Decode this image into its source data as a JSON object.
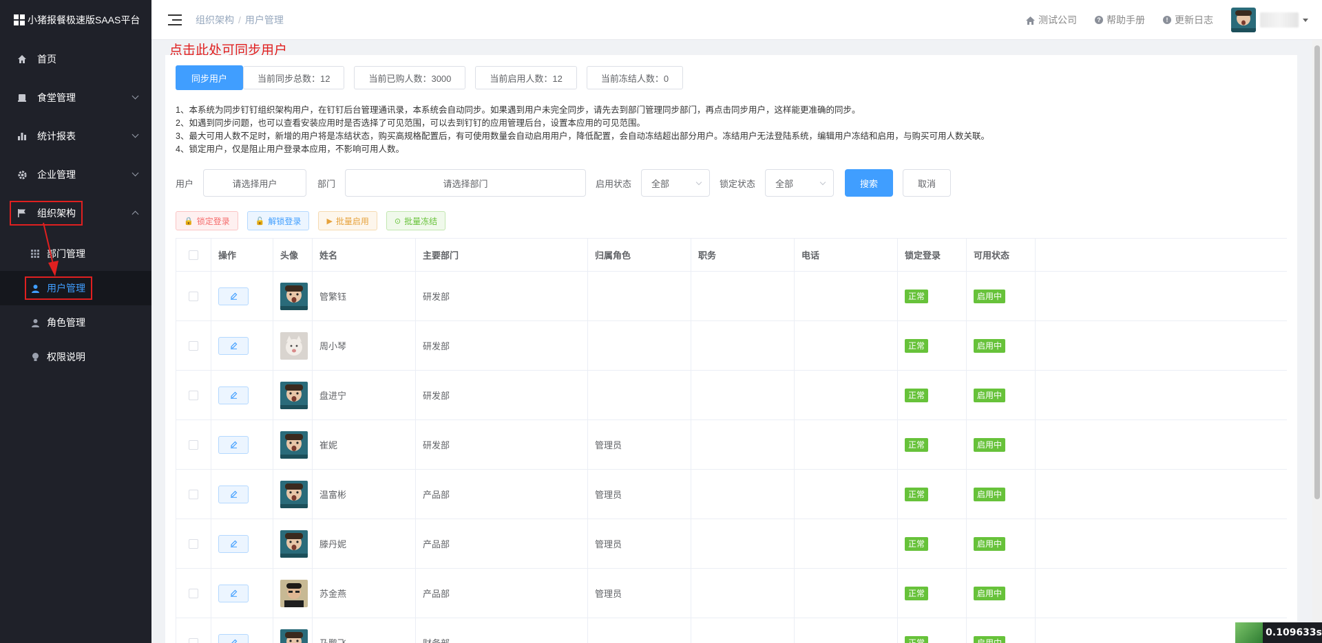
{
  "app": {
    "title": "小猪报餐极速版SAAS平台"
  },
  "sidebar": {
    "items": [
      {
        "label": "首页",
        "icon": "home-icon",
        "expandable": false
      },
      {
        "label": "食堂管理",
        "icon": "canteen-icon",
        "expandable": true
      },
      {
        "label": "统计报表",
        "icon": "chart-icon",
        "expandable": true
      },
      {
        "label": "企业管理",
        "icon": "gear-icon",
        "expandable": true
      },
      {
        "label": "组织架构",
        "icon": "flag-icon",
        "expandable": true,
        "expanded": true
      }
    ],
    "subitems": [
      {
        "label": "部门管理",
        "icon": "grid-icon"
      },
      {
        "label": "用户管理",
        "icon": "user-icon",
        "active": true
      },
      {
        "label": "角色管理",
        "icon": "user-icon"
      },
      {
        "label": "权限说明",
        "icon": "bulb-icon"
      }
    ]
  },
  "header": {
    "breadcrumb": [
      "组织架构",
      "用户管理"
    ],
    "links": [
      {
        "label": "测试公司",
        "icon": "home-icon"
      },
      {
        "label": "帮助手册",
        "icon": "question-icon"
      },
      {
        "label": "更新日志",
        "icon": "info-icon"
      }
    ]
  },
  "annotation": "点击此处可同步用户",
  "sync": {
    "button": "同步用户",
    "stats": [
      "当前同步总数：12",
      "当前已购人数：3000",
      "当前启用人数：12",
      "当前冻结人数：0"
    ]
  },
  "notes": [
    "1、本系统为同步钉钉组织架构用户，在钉钉后台管理通讯录，本系统会自动同步。如果遇到用户未完全同步，请先去到部门管理同步部门，再点击同步用户，这样能更准确的同步。",
    "2、如遇到同步问题，也可以查看安装应用时是否选择了可见范围，可以去到钉钉的应用管理后台，设置本应用的可见范围。",
    "3、最大可用人数不足时，新增的用户将是冻结状态，购买高规格配置后，有可使用数量会自动启用用户，降低配置，会自动冻结超出部分用户。冻结用户无法登陆系统，编辑用户冻结和启用，与购买可用人数关联。",
    "4、锁定用户，仅是阻止用户登录本应用，不影响可用人数。"
  ],
  "filters": {
    "user_label": "用户",
    "user_placeholder": "请选择用户",
    "dept_label": "部门",
    "dept_placeholder": "请选择部门",
    "enable_label": "启用状态",
    "enable_value": "全部",
    "lock_label": "锁定状态",
    "lock_value": "全部",
    "search": "搜索",
    "cancel": "取消"
  },
  "actions": [
    "锁定登录",
    "解锁登录",
    "批量启用",
    "批量冻结"
  ],
  "table": {
    "headers": [
      "操作",
      "头像",
      "姓名",
      "主要部门",
      "归属角色",
      "职务",
      "电话",
      "锁定登录",
      "可用状态"
    ],
    "rows": [
      {
        "name": "管繁钰",
        "dept": "研发部",
        "role": "",
        "position": "",
        "phone": "",
        "lock": "正常",
        "status": "启用中",
        "avatar": "boy"
      },
      {
        "name": "周小琴",
        "dept": "研发部",
        "role": "",
        "position": "",
        "phone": "",
        "lock": "正常",
        "status": "启用中",
        "avatar": "cat"
      },
      {
        "name": "盘进宁",
        "dept": "研发部",
        "role": "",
        "position": "",
        "phone": "",
        "lock": "正常",
        "status": "启用中",
        "avatar": "boy"
      },
      {
        "name": "崔妮",
        "dept": "研发部",
        "role": "管理员",
        "position": "",
        "phone": "",
        "lock": "正常",
        "status": "启用中",
        "avatar": "boy"
      },
      {
        "name": "温富彬",
        "dept": "产品部",
        "role": "管理员",
        "position": "",
        "phone": "",
        "lock": "正常",
        "status": "启用中",
        "avatar": "boy"
      },
      {
        "name": "滕丹妮",
        "dept": "产品部",
        "role": "管理员",
        "position": "",
        "phone": "",
        "lock": "正常",
        "status": "启用中",
        "avatar": "boy"
      },
      {
        "name": "苏金燕",
        "dept": "产品部",
        "role": "管理员",
        "position": "",
        "phone": "",
        "lock": "正常",
        "status": "启用中",
        "avatar": "man"
      },
      {
        "name": "乃鹏飞",
        "dept": "财务部",
        "role": "",
        "position": "",
        "phone": "",
        "lock": "正常",
        "status": "启用中",
        "avatar": "boy"
      }
    ]
  },
  "timer": "0.109633s",
  "colors": {
    "sidebar_bg": "#1f2129",
    "primary": "#409eff",
    "success": "#67c23a",
    "danger": "#f56c6c",
    "annotation": "#e02020"
  }
}
